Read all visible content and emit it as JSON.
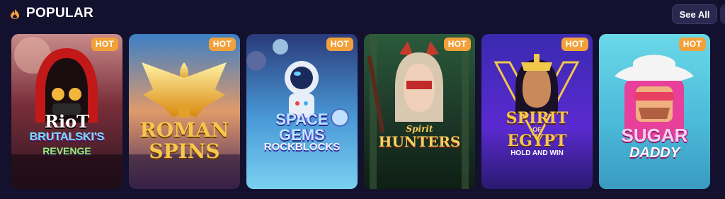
{
  "section": {
    "icon": "fire-icon",
    "title": "POPULAR",
    "see_all_label": "See All"
  },
  "games": [
    {
      "title_lines": [
        "RioT",
        "BRUTALSKI'S",
        "REVENGE"
      ],
      "badge": "HOT",
      "theme": "red hooded rioter"
    },
    {
      "title_lines": [
        "ROMAN",
        "SPINS"
      ],
      "badge": "HOT",
      "theme": "golden eagle"
    },
    {
      "title_lines": [
        "SPACE",
        "GEMS",
        "ROCKBLOCKS"
      ],
      "badge": "HOT",
      "theme": "astronaut"
    },
    {
      "title_lines": [
        "Spirit",
        "HUNTERS"
      ],
      "badge": "HOT",
      "theme": "fox warrior"
    },
    {
      "title_lines": [
        "SPIRIT",
        "OF",
        "EGYPT",
        "HOLD AND WIN"
      ],
      "badge": "HOT",
      "theme": "cleopatra"
    },
    {
      "title_lines": [
        "SUGAR",
        "DADDY"
      ],
      "badge": "HOT",
      "theme": "cowboy"
    }
  ],
  "colors": {
    "background": "#13112e",
    "badge": "#f2a13a",
    "button": "#2b2850"
  }
}
